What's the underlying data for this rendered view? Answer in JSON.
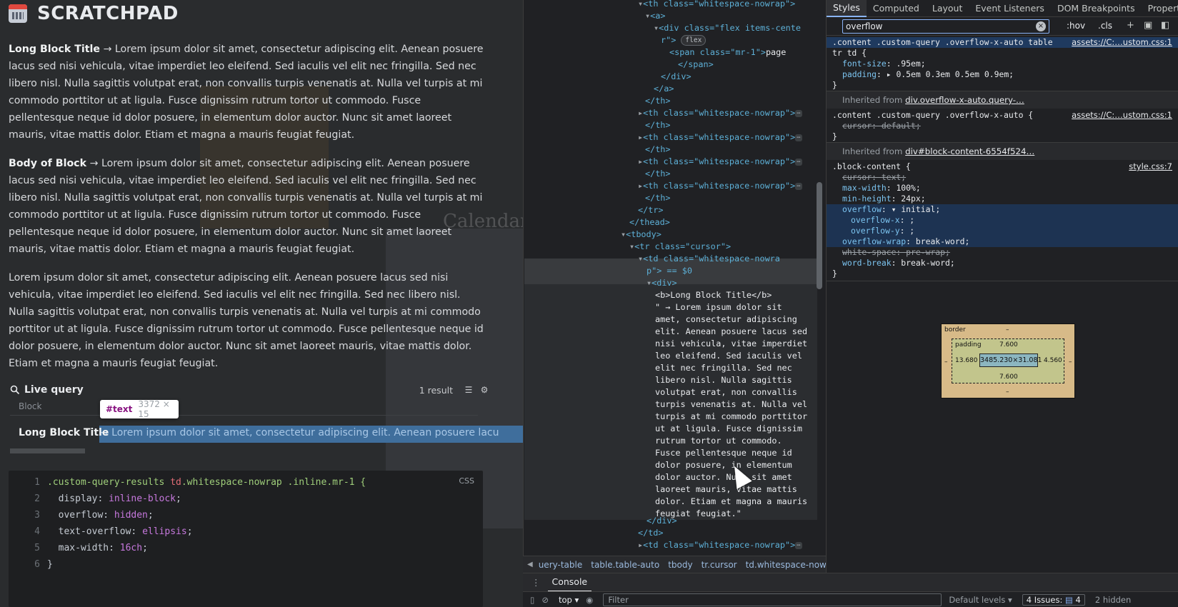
{
  "scratchpad": {
    "title": "SCRATCHPAD",
    "paragraph1": {
      "bold": "Long Block Title",
      "text": " → Lorem ipsum dolor sit amet, consectetur adipiscing elit. Aenean posuere lacus sed nisi vehicula, vitae imperdiet leo eleifend. Sed iaculis vel elit nec fringilla. Sed nec libero nisl. Nulla sagittis volutpat erat, non convallis turpis venenatis at. Nulla vel turpis at mi commodo porttitor ut at ligula. Fusce dignissim rutrum tortor ut commodo. Fusce pellentesque neque id dolor posuere, in elementum dolor auctor. Nunc sit amet laoreet mauris, vitae mattis dolor. Etiam et magna a mauris feugiat feugiat."
    },
    "paragraph2": {
      "bold": "Body of Block",
      "text": " → Lorem ipsum dolor sit amet, consectetur adipiscing elit. Aenean posuere lacus sed nisi vehicula, vitae imperdiet leo eleifend. Sed iaculis vel elit nec fringilla. Sed nec libero nisl. Nulla sagittis volutpat erat, non convallis turpis venenatis at. Nulla vel turpis at mi commodo porttitor ut at ligula. Fusce dignissim rutrum tortor ut commodo. Fusce pellentesque neque id dolor posuere, in elementum dolor auctor. Nunc sit amet laoreet mauris, vitae mattis dolor. Etiam et magna a mauris feugiat feugiat."
    },
    "paragraph3": "Lorem ipsum dolor sit amet, consectetur adipiscing elit. Aenean posuere lacus sed nisi vehicula, vitae imperdiet leo eleifend. Sed iaculis vel elit nec fringilla. Sed nec libero nisl. Nulla sagittis volutpat erat, non convallis turpis venenatis at. Nulla vel turpis at mi commodo porttitor ut at ligula. Fusce dignissim rutrum tortor ut commodo. Fusce pellentesque neque id dolor posuere, in elementum dolor auctor. Nunc sit amet laoreet mauris, vitae mattis dolor. Etiam et magna a mauris feugiat feugiat.",
    "live_query": {
      "title": "Live query",
      "result_count": "1 result",
      "column_header": "Block",
      "row": {
        "block": "Long Block Title",
        "text": "→ Lorem ipsum dolor sit amet, consectetur adipiscing elit. Aenean posuere lacu"
      }
    },
    "tooltip": {
      "node": "#text",
      "size": "3372 × 15"
    },
    "code": {
      "lang": "CSS",
      "lines": [
        {
          "n": "1",
          "sel1": ".custom-query-results ",
          "tag": "td",
          "sel2": ".whitespace-nowrap .inline.mr-1 {"
        },
        {
          "n": "2",
          "prop": "  display: ",
          "val": "inline-block",
          "end": ";"
        },
        {
          "n": "3",
          "prop": "  overflow: ",
          "val": "hidden",
          "end": ";"
        },
        {
          "n": "4",
          "prop": "  text-overflow: ",
          "val": "ellipsis",
          "end": ";"
        },
        {
          "n": "5",
          "prop": "  max-width: ",
          "val": "16ch",
          "end": ";"
        },
        {
          "n": "6",
          "prop": "}",
          "val": "",
          "end": ""
        }
      ]
    }
  },
  "dom": {
    "l0": "<th class=\"whitespace-nowrap\">",
    "l1": "<a>",
    "l2a": "<div class=\"flex items-cente",
    "l2b": "r\">",
    "flex_badge": "flex",
    "l3a": "<span class=\"mr-1\">",
    "l3b": "page",
    "l4": "</span>",
    "l5": "</div>",
    "l6": "</a>",
    "l7": "</th>",
    "th_repeat": "<th class=\"whitespace-nowrap\">",
    "th_close": "</th>",
    "tr_close": "</tr>",
    "thead_close": "</thead>",
    "tbody": "<tbody>",
    "tr_cursor": "<tr class=\"cursor\">",
    "td_a": "<td class=\"whitespace-nowra",
    "td_b": "p\"> == $0",
    "div_open": "<div>",
    "b_line": "<b>Long Block Title</b>",
    "text_lines": [
      "\" → Lorem ipsum dolor sit",
      "amet, consectetur adipiscing",
      "elit. Aenean posuere lacus sed",
      "nisi vehicula, vitae imperdiet",
      "leo eleifend. Sed iaculis vel",
      "elit nec fringilla. Sed nec",
      "libero nisl. Nulla sagittis",
      "volutpat erat, non convallis",
      "turpis venenatis at. Nulla vel",
      "turpis at mi commodo porttitor",
      "ut at ligula. Fusce dignissim",
      "rutrum tortor ut commodo.",
      "Fusce pellentesque neque id",
      "dolor posuere, in elementum",
      "dolor auctor. Nunc sit amet",
      "laoreet mauris, vitae mattis",
      "dolor. Etiam et magna a mauris",
      "feugiat feugiat.\""
    ],
    "div_close": "</div>",
    "td_close": "</td>",
    "td_next": "<td class=\"whitespace-nowrap\">"
  },
  "breadcrumbs": [
    "uery-table",
    "table.table-auto",
    "tbody",
    "tr.cursor",
    "td.whitespace-nowrap"
  ],
  "console": {
    "tab": "Console",
    "context": "top",
    "filter_placeholder": "Filter",
    "levels": "Default levels",
    "issues_label": "4 Issues:",
    "issues_count": "4",
    "hidden": "2 hidden"
  },
  "styles": {
    "tabs": [
      "Styles",
      "Computed",
      "Layout",
      "Event Listeners",
      "DOM Breakpoints",
      "Properties"
    ],
    "filter_value": "overflow",
    "hov": ":hov",
    "cls": ".cls",
    "rule1": {
      "selector": ".content .custom-query .overflow-x-auto table",
      "selector2": "tr td {",
      "source": "assets://C:…ustom.css:1",
      "decls": [
        {
          "p": "font-size",
          "v": ".95em;"
        },
        {
          "p": "padding",
          "v": "0.5em 0.3em 0.5em 0.9em;"
        }
      ]
    },
    "inherited1": {
      "label": "Inherited from ",
      "link": "div.overflow-x-auto.query-…"
    },
    "rule2": {
      "selector": ".content .custom-query .overflow-x-auto {",
      "source": "assets://C:…ustom.css:1",
      "decl": "cursor: default;"
    },
    "inherited2": {
      "label": "Inherited from ",
      "link": "div#block-content-6554f524…"
    },
    "rule3": {
      "selector": ".block-content {",
      "source": "style.css:7",
      "d1": "cursor: text;",
      "d2p": "max-width",
      "d2v": "100%;",
      "d3p": "min-height",
      "d3v": "24px;",
      "d4p": "overflow",
      "d4v": "initial;",
      "d5p": "overflow-x",
      "d5v": ";",
      "d6p": "overflow-y",
      "d6v": ";",
      "d7p": "overflow-wrap",
      "d7v": "break-word;",
      "d8": "white-space: pre-wrap;",
      "d9p": "word-break",
      "d9v": "break-word;"
    },
    "boxmodel": {
      "border": "border",
      "border_val": "–",
      "padding": "padding",
      "pad_top": "7.600",
      "pad_bottom": "7.600",
      "pad_left": "13.680",
      "pad_right": "4.560",
      "content": "3485.230×31.081",
      "margin_left": "–",
      "margin_right": "–"
    }
  },
  "background": {
    "ghost_title": "Calendar ortodox - Decembrie"
  }
}
